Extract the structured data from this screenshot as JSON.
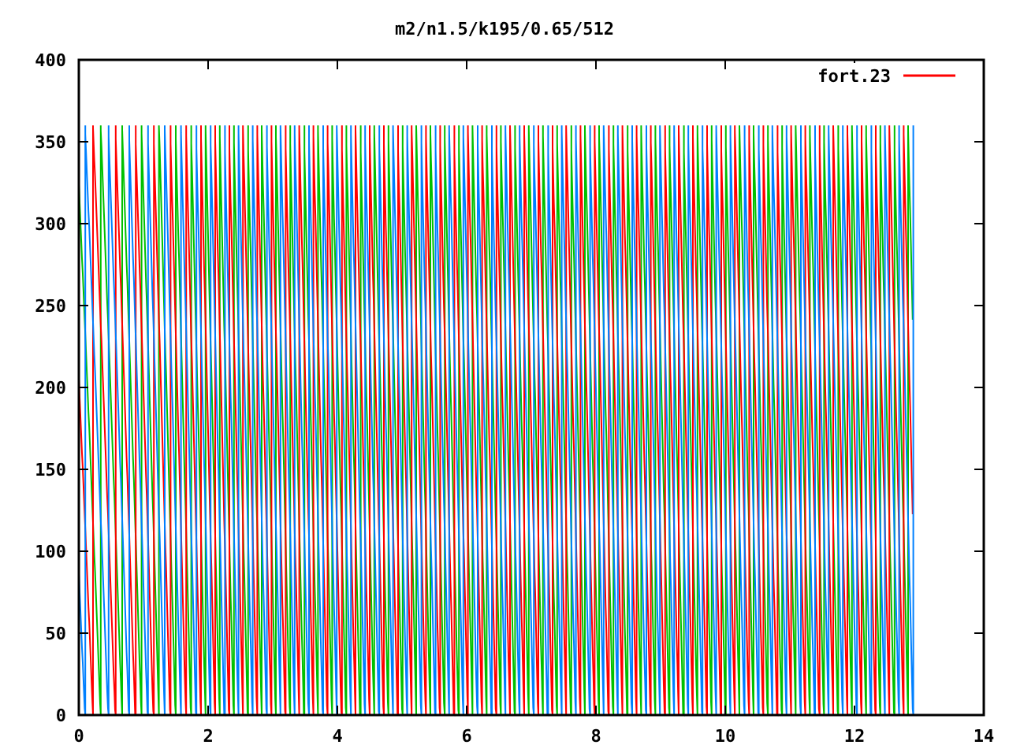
{
  "title": "m2/n1.5/k195/0.65/512",
  "legend": {
    "label": "fort.23"
  },
  "x_ticks": [
    "0",
    "2",
    "4",
    "6",
    "8",
    "10",
    "12",
    "14"
  ],
  "y_ticks": [
    "400",
    "350",
    "300",
    "250",
    "200",
    "150",
    "100",
    "50",
    "0"
  ]
}
